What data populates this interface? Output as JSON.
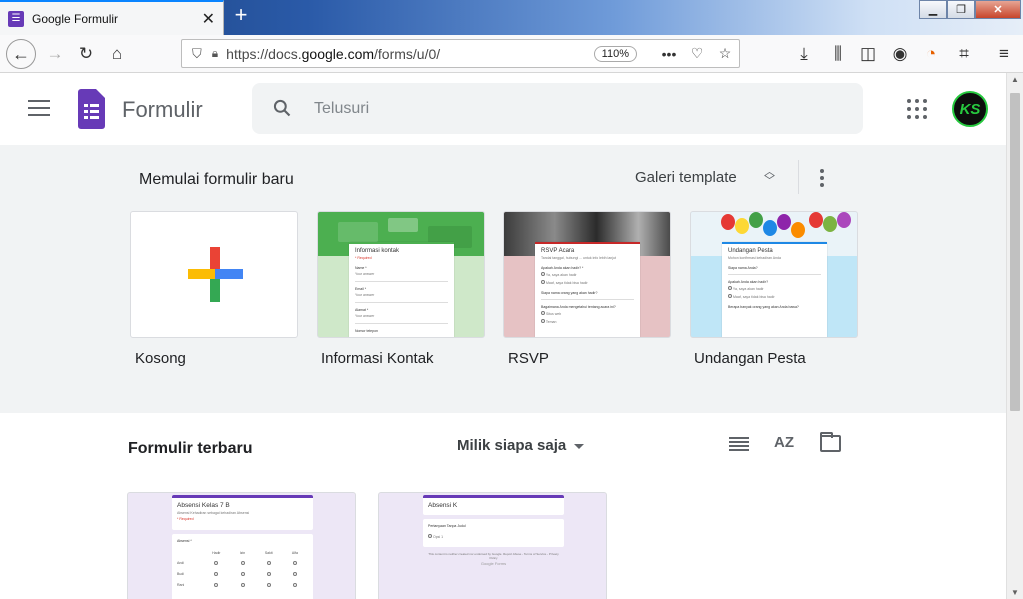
{
  "browser": {
    "tab_title": "Google Formulir",
    "tab_close": "✕",
    "new_tab": "+",
    "url_prefix": "https://docs.",
    "url_domain": "google.com",
    "url_path": "/forms/u/0/",
    "zoom": "110%"
  },
  "app": {
    "title": "Formulir",
    "search_placeholder": "Telusuri",
    "avatar_initials": "KS"
  },
  "start": {
    "title": "Memulai formulir baru",
    "gallery_label": "Galeri template",
    "templates": [
      {
        "label": "Kosong"
      },
      {
        "label": "Informasi Kontak",
        "thumb_title": "Informasi kontak",
        "thumb_sub": "* Required",
        "q1": "Name *",
        "q2": "Email *",
        "q3": "Alamat *",
        "q4": "Nomor telepon",
        "placeholder": "Your answer"
      },
      {
        "label": "RSVP",
        "thumb_title": "RSVP Acara",
        "thumb_sub": "Tandai tanggal, hubungi ... untuk info lebih lanjut",
        "q1": "Apakah Anda akan hadir? *",
        "o1": "Ya, saya akan hadir",
        "o2": "Maaf, saya tidak bisa hadir",
        "q2": "Siapa nama orang yang akan hadir?",
        "q3": "Bagaimana Anda mengetahui tentang acara ini?",
        "o3": "Situs web",
        "o4": "Teman"
      },
      {
        "label": "Undangan Pesta",
        "thumb_title": "Undangan Pesta",
        "thumb_sub": "Mohon konfirmasi kehadiran Anda",
        "q1": "Siapa nama Anda?",
        "q2": "Apakah Anda akan hadir?",
        "o1": "Ya, saya akan hadir",
        "o2": "Maaf, saya tidak bisa hadir",
        "q3": "Berapa banyak orang yang akan Anda bawa?"
      }
    ]
  },
  "recent": {
    "title": "Formulir terbaru",
    "owner_filter": "Milik siapa saja",
    "sort_label": "AZ",
    "docs": [
      {
        "title": "Absensi Kelas 7 B",
        "desc": "Absensi Kehadiran sebagai kehadiran Absensi",
        "req": "* Required",
        "q": "Absensi *",
        "cols": [
          "Hadir",
          "Izin",
          "Sakit",
          "Alfa"
        ],
        "rows": [
          "Andi",
          "Budi",
          "Rani"
        ]
      },
      {
        "title": "Absensi K",
        "q": "Pertanyaan Tanpa Judul",
        "opt": "Opsi 1",
        "footer": "This content is neither created nor endorsed by Google. Report Abuse - Terms of Service - Privacy Policy",
        "brand": "Google Forms"
      }
    ]
  },
  "colors": {
    "accent": "#673ab7",
    "start_bg": "#f1f3f4",
    "contact_green": "#4caf50",
    "rsvp_pink": "#e6c2c4",
    "party_blue": "#bfe6f7"
  }
}
